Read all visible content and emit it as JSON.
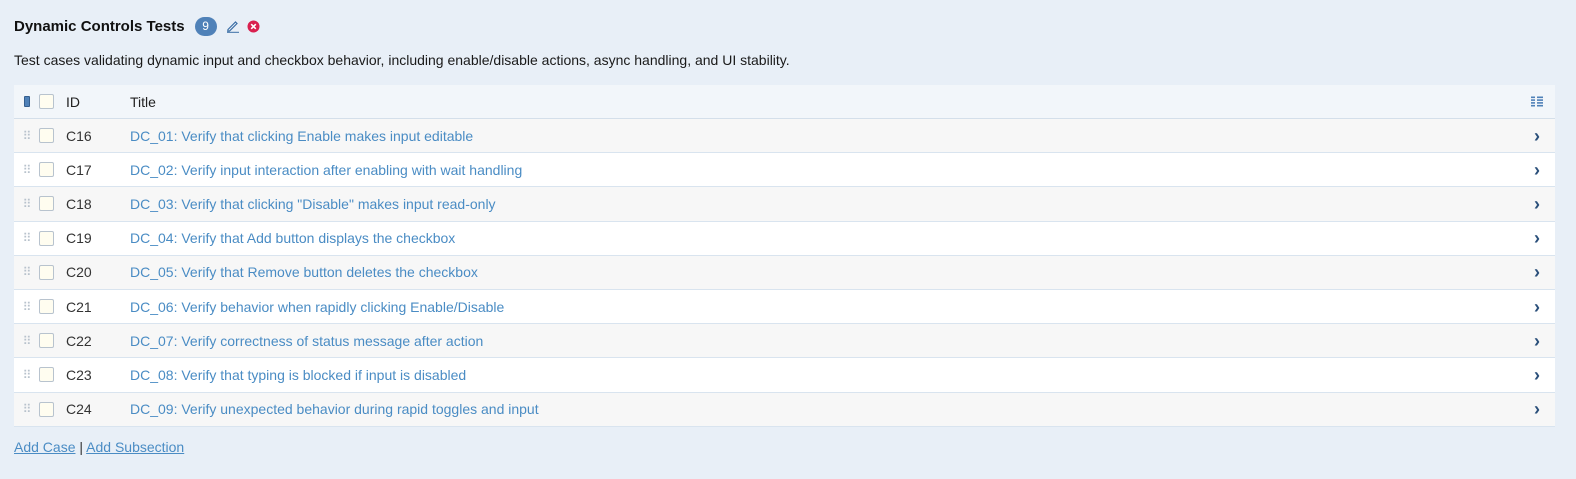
{
  "section": {
    "title": "Dynamic Controls Tests",
    "count": "9",
    "description": "Test cases validating dynamic input and checkbox behavior, including enable/disable actions, async handling, and UI stability.",
    "edit_icon": "pencil-icon",
    "delete_icon": "close-circle-icon"
  },
  "table": {
    "columns": {
      "id": "ID",
      "title": "Title"
    },
    "column_settings_icon": "columns-icon",
    "rows": [
      {
        "id": "C16",
        "title": "DC_01: Verify that clicking Enable makes input editable"
      },
      {
        "id": "C17",
        "title": "DC_02: Verify input interaction after enabling with wait handling"
      },
      {
        "id": "C18",
        "title": "DC_03: Verify that clicking \"Disable\" makes input read-only"
      },
      {
        "id": "C19",
        "title": "DC_04: Verify that Add button displays the checkbox"
      },
      {
        "id": "C20",
        "title": "DC_05: Verify that Remove button deletes the checkbox"
      },
      {
        "id": "C21",
        "title": "DC_06: Verify behavior when rapidly clicking Enable/Disable"
      },
      {
        "id": "C22",
        "title": "DC_07: Verify correctness of status message after action"
      },
      {
        "id": "C23",
        "title": "DC_08: Verify that typing is blocked if input is disabled"
      },
      {
        "id": "C24",
        "title": "DC_09: Verify unexpected behavior during rapid toggles and input"
      }
    ]
  },
  "footer": {
    "add_case": "Add Case",
    "separator": "|",
    "add_subsection": "Add Subsection"
  },
  "colors": {
    "accent": "#4f81b8",
    "link": "#4a8cc4",
    "delete": "#d9204f",
    "background": "#e8eff7"
  }
}
